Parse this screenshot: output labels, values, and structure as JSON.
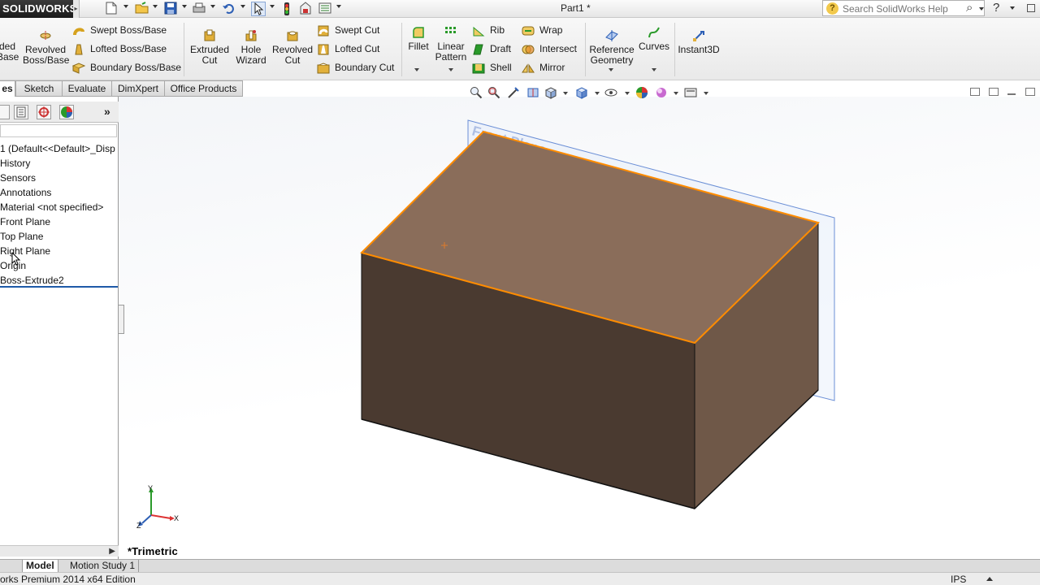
{
  "app": {
    "logo_text": "SOLIDWORKS",
    "doc_title": "Part1 *"
  },
  "search": {
    "placeholder": "Search SolidWorks Help"
  },
  "commands": {
    "extruded_boss_line1": "ded",
    "extruded_boss_line2": "Base",
    "revolved_boss_line1": "Revolved",
    "revolved_boss_line2": "Boss/Base",
    "swept_boss": "Swept Boss/Base",
    "lofted_boss": "Lofted Boss/Base",
    "boundary_boss": "Boundary Boss/Base",
    "extruded_cut_line1": "Extruded",
    "extruded_cut_line2": "Cut",
    "hole_wizard_line1": "Hole",
    "hole_wizard_line2": "Wizard",
    "revolved_cut_line1": "Revolved",
    "revolved_cut_line2": "Cut",
    "swept_cut": "Swept Cut",
    "lofted_cut": "Lofted Cut",
    "boundary_cut": "Boundary Cut",
    "fillet": "Fillet",
    "linear_pattern_line1": "Linear",
    "linear_pattern_line2": "Pattern",
    "rib": "Rib",
    "draft": "Draft",
    "shell": "Shell",
    "wrap": "Wrap",
    "intersect": "Intersect",
    "mirror": "Mirror",
    "reference_geometry_line1": "Reference",
    "reference_geometry_line2": "Geometry",
    "curves": "Curves",
    "instant3d": "Instant3D"
  },
  "tabs": [
    {
      "label": "es"
    },
    {
      "label": "Sketch"
    },
    {
      "label": "Evaluate"
    },
    {
      "label": "DimXpert"
    },
    {
      "label": "Office Products"
    }
  ],
  "tree": {
    "items": [
      {
        "label": "1  (Default<<Default>_Disp"
      },
      {
        "label": "History"
      },
      {
        "label": "Sensors"
      },
      {
        "label": "Annotations"
      },
      {
        "label": "Material <not specified>"
      },
      {
        "label": "Front Plane"
      },
      {
        "label": "Top Plane"
      },
      {
        "label": "Right Plane"
      },
      {
        "label": "Origin"
      },
      {
        "label": "Boss-Extrude2"
      }
    ]
  },
  "graphics": {
    "plane_label": "Front Plane",
    "view_label": "*Trimetric",
    "triad": {
      "x": "X",
      "y": "Y",
      "z": "Z"
    },
    "colors": {
      "top_face": "#8a6d5a",
      "front_face": "#4a3a30",
      "right_face": "#6f5848",
      "highlight_edge": "#ff8c00",
      "plane": "#6b8fd6"
    }
  },
  "bottom_tabs": [
    {
      "label": "Model"
    },
    {
      "label": "Motion Study 1"
    }
  ],
  "status": {
    "text": "orks Premium 2014 x64 Edition",
    "units": "IPS"
  }
}
